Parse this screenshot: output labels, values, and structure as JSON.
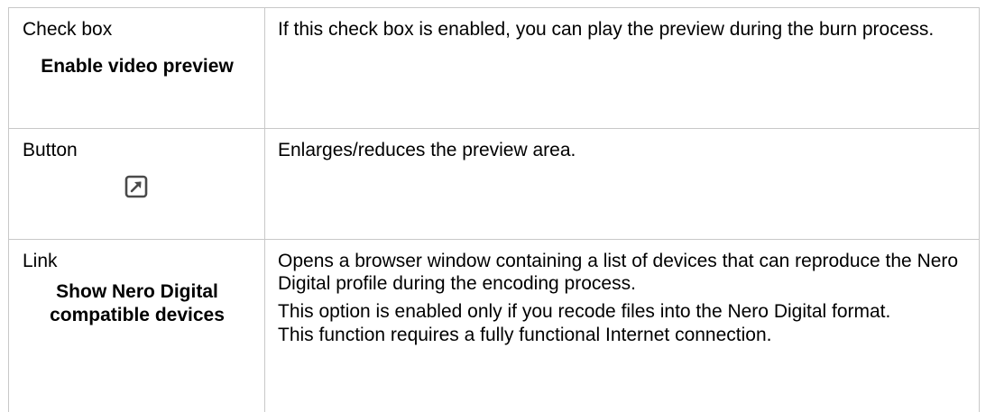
{
  "rows": [
    {
      "element_type": "Check box",
      "element_name": "Enable video preview",
      "description": [
        "If this check box is enabled, you can play the preview during the burn process."
      ]
    },
    {
      "element_type": "Button",
      "element_icon": "enlarge-arrow-icon",
      "description": [
        "Enlarges/reduces the preview area."
      ]
    },
    {
      "element_type": "Link",
      "element_name": "Show Nero Digital compatible devices",
      "description": [
        "Opens a browser window containing a list of devices that can reproduce the Nero Digital profile during the encoding process.",
        "This option is enabled only if you recode files into the Nero Digital format.",
        "This function requires a fully functional Internet connection."
      ]
    }
  ],
  "colors": {
    "border": "#c8c8c8",
    "text": "#000000",
    "icon": "#4a4a4a"
  }
}
